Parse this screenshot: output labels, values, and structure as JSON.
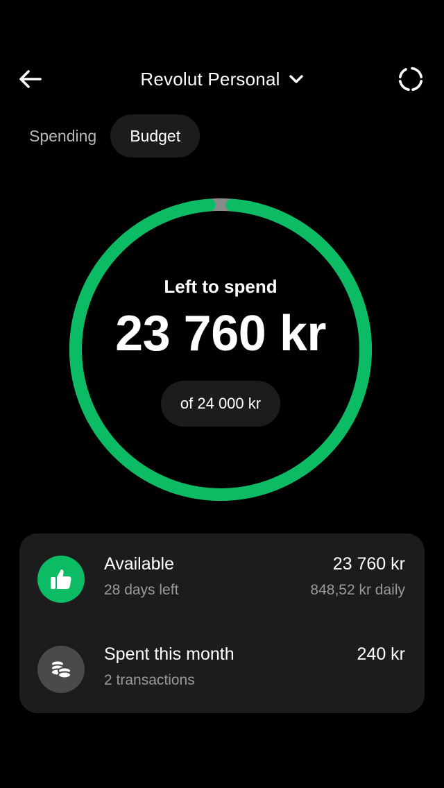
{
  "header": {
    "account_title": "Revolut Personal"
  },
  "tabs": [
    {
      "label": "Spending",
      "active": false
    },
    {
      "label": "Budget",
      "active": true
    }
  ],
  "budget": {
    "label": "Left to spend",
    "amount": "23 760 kr",
    "total_label": "of 24 000 kr",
    "left_fraction": 0.99
  },
  "summary": {
    "available": {
      "title": "Available",
      "subtitle": "28 days left",
      "amount": "23 760 kr",
      "daily": "848,52 kr daily",
      "icon": "thumbs-up-icon"
    },
    "spent": {
      "title": "Spent this month",
      "subtitle": "2 transactions",
      "amount": "240 kr",
      "icon": "coins-icon"
    }
  },
  "colors": {
    "background": "#000000",
    "accent": "#0cbc64",
    "spent_segment": "#8a8a8a",
    "card": "#1c1c1e",
    "secondary_text": "#9a9a9a"
  }
}
